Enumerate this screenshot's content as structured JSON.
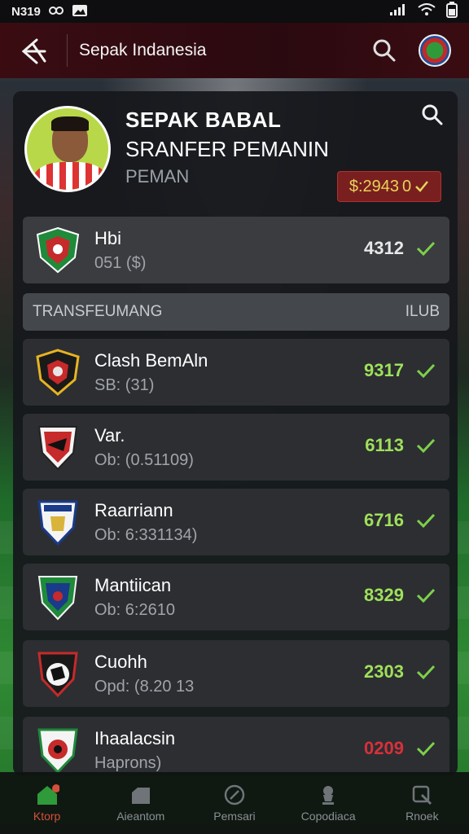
{
  "status_bar": {
    "time": "N319",
    "left_icons": [
      "media-icon",
      "image-icon"
    ],
    "right_icons": [
      "signal-icon",
      "wifi-icon",
      "battery-icon"
    ]
  },
  "header": {
    "title": "Sepak Indanesia"
  },
  "profile": {
    "title_line1": "SEPAK BABAL",
    "title_line2": "SRANFER PEMANIN",
    "subtitle": "PEMAN",
    "price": "$:2943",
    "price_suffix": "0"
  },
  "featured": {
    "name": "Hbi",
    "sub": "051 ($)",
    "value": "4312",
    "value_color": "#e8e8e8"
  },
  "section": {
    "left": "TRANSFEUMANG",
    "right": "ILUB"
  },
  "transfers": [
    {
      "name": "Clash BemAln",
      "sub": "SB: (31)",
      "value": "9317",
      "value_color": "#9fe05a"
    },
    {
      "name": "Var.",
      "sub": "Ob: (0.51109)",
      "value": "6113",
      "value_color": "#9fe05a"
    },
    {
      "name": "Raarriann",
      "sub": "Ob: 6:331134)",
      "value": "6716",
      "value_color": "#9fe05a"
    },
    {
      "name": "Mantiican",
      "sub": "Ob: 6:2610",
      "value": "8329",
      "value_color": "#9fe05a"
    },
    {
      "name": "Cuohh",
      "sub": "Opd: (8.20 13",
      "value": "2303",
      "value_color": "#9fe05a"
    },
    {
      "name": "Ihaalacsin",
      "sub": "Haprons)",
      "value": "0209",
      "value_color": "#d8303a"
    }
  ],
  "nav": [
    {
      "label": "Ktorp",
      "icon": "home-icon",
      "active": true
    },
    {
      "label": "Aieantom",
      "icon": "stadium-icon",
      "active": false
    },
    {
      "label": "Pemsari",
      "icon": "ball-icon",
      "active": false
    },
    {
      "label": "Copodiaca",
      "icon": "trophy-icon",
      "active": false
    },
    {
      "label": "Rnoek",
      "icon": "news-icon",
      "active": false
    }
  ]
}
